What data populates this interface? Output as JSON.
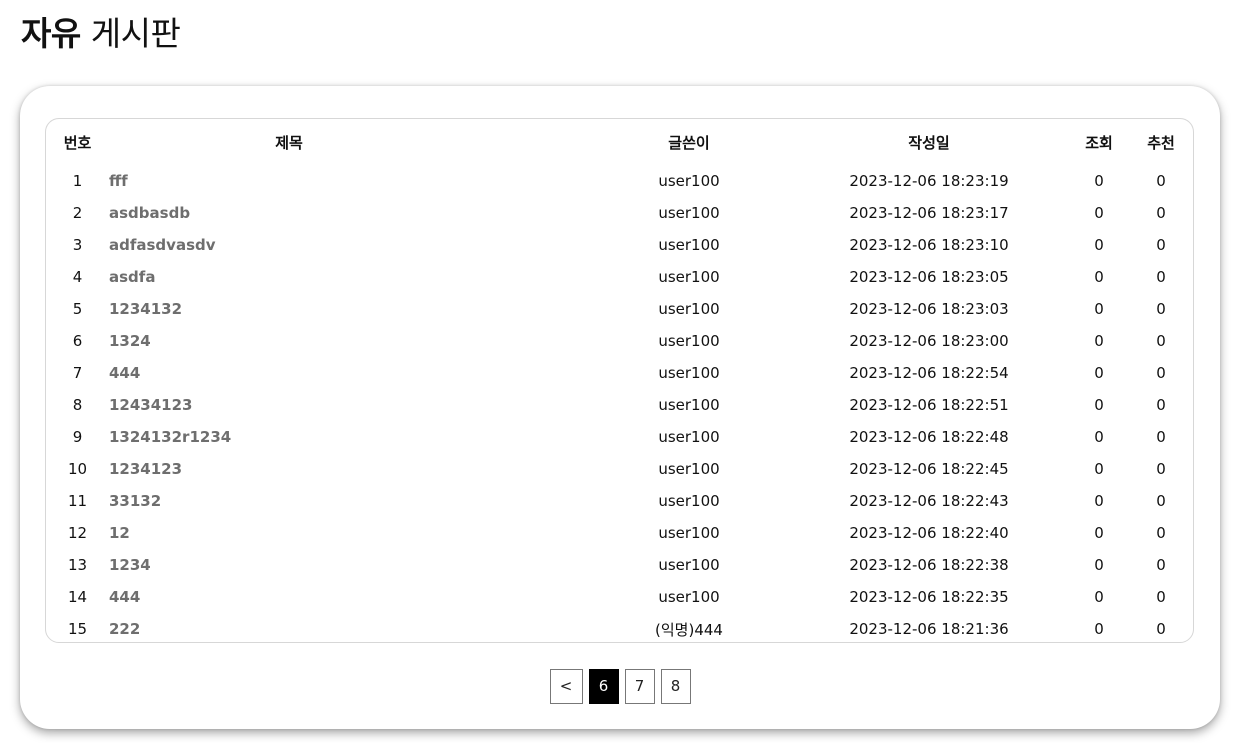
{
  "header": {
    "title_bold": "자유",
    "title_rest": "게시판"
  },
  "table": {
    "columns": [
      "번호",
      "제목",
      "글쓴이",
      "작성일",
      "조회",
      "추천"
    ],
    "rows": [
      {
        "no": "1",
        "title": "fff",
        "author": "user100",
        "date": "2023-12-06 18:23:19",
        "views": "0",
        "recommend": "0"
      },
      {
        "no": "2",
        "title": "asdbasdb",
        "author": "user100",
        "date": "2023-12-06 18:23:17",
        "views": "0",
        "recommend": "0"
      },
      {
        "no": "3",
        "title": "adfasdvasdv",
        "author": "user100",
        "date": "2023-12-06 18:23:10",
        "views": "0",
        "recommend": "0"
      },
      {
        "no": "4",
        "title": "asdfa",
        "author": "user100",
        "date": "2023-12-06 18:23:05",
        "views": "0",
        "recommend": "0"
      },
      {
        "no": "5",
        "title": "1234132",
        "author": "user100",
        "date": "2023-12-06 18:23:03",
        "views": "0",
        "recommend": "0"
      },
      {
        "no": "6",
        "title": "1324",
        "author": "user100",
        "date": "2023-12-06 18:23:00",
        "views": "0",
        "recommend": "0"
      },
      {
        "no": "7",
        "title": "444",
        "author": "user100",
        "date": "2023-12-06 18:22:54",
        "views": "0",
        "recommend": "0"
      },
      {
        "no": "8",
        "title": "12434123",
        "author": "user100",
        "date": "2023-12-06 18:22:51",
        "views": "0",
        "recommend": "0"
      },
      {
        "no": "9",
        "title": "1324132r1234",
        "author": "user100",
        "date": "2023-12-06 18:22:48",
        "views": "0",
        "recommend": "0"
      },
      {
        "no": "10",
        "title": "1234123",
        "author": "user100",
        "date": "2023-12-06 18:22:45",
        "views": "0",
        "recommend": "0"
      },
      {
        "no": "11",
        "title": "33132",
        "author": "user100",
        "date": "2023-12-06 18:22:43",
        "views": "0",
        "recommend": "0"
      },
      {
        "no": "12",
        "title": "12",
        "author": "user100",
        "date": "2023-12-06 18:22:40",
        "views": "0",
        "recommend": "0"
      },
      {
        "no": "13",
        "title": "1234",
        "author": "user100",
        "date": "2023-12-06 18:22:38",
        "views": "0",
        "recommend": "0"
      },
      {
        "no": "14",
        "title": "444",
        "author": "user100",
        "date": "2023-12-06 18:22:35",
        "views": "0",
        "recommend": "0"
      },
      {
        "no": "15",
        "title": "222",
        "author": "(익명)444",
        "date": "2023-12-06 18:21:36",
        "views": "0",
        "recommend": "0"
      }
    ]
  },
  "pagination": {
    "prev_label": "<",
    "pages": [
      "6",
      "7",
      "8"
    ],
    "current": "6"
  }
}
